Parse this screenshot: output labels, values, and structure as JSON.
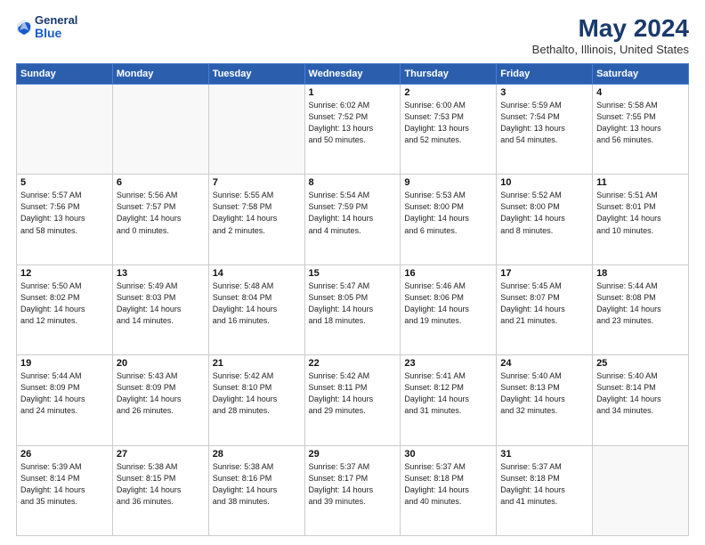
{
  "logo": {
    "general": "General",
    "blue": "Blue"
  },
  "header": {
    "month_year": "May 2024",
    "location": "Bethalto, Illinois, United States"
  },
  "weekdays": [
    "Sunday",
    "Monday",
    "Tuesday",
    "Wednesday",
    "Thursday",
    "Friday",
    "Saturday"
  ],
  "weeks": [
    [
      {
        "day": "",
        "info": ""
      },
      {
        "day": "",
        "info": ""
      },
      {
        "day": "",
        "info": ""
      },
      {
        "day": "1",
        "info": "Sunrise: 6:02 AM\nSunset: 7:52 PM\nDaylight: 13 hours\nand 50 minutes."
      },
      {
        "day": "2",
        "info": "Sunrise: 6:00 AM\nSunset: 7:53 PM\nDaylight: 13 hours\nand 52 minutes."
      },
      {
        "day": "3",
        "info": "Sunrise: 5:59 AM\nSunset: 7:54 PM\nDaylight: 13 hours\nand 54 minutes."
      },
      {
        "day": "4",
        "info": "Sunrise: 5:58 AM\nSunset: 7:55 PM\nDaylight: 13 hours\nand 56 minutes."
      }
    ],
    [
      {
        "day": "5",
        "info": "Sunrise: 5:57 AM\nSunset: 7:56 PM\nDaylight: 13 hours\nand 58 minutes."
      },
      {
        "day": "6",
        "info": "Sunrise: 5:56 AM\nSunset: 7:57 PM\nDaylight: 14 hours\nand 0 minutes."
      },
      {
        "day": "7",
        "info": "Sunrise: 5:55 AM\nSunset: 7:58 PM\nDaylight: 14 hours\nand 2 minutes."
      },
      {
        "day": "8",
        "info": "Sunrise: 5:54 AM\nSunset: 7:59 PM\nDaylight: 14 hours\nand 4 minutes."
      },
      {
        "day": "9",
        "info": "Sunrise: 5:53 AM\nSunset: 8:00 PM\nDaylight: 14 hours\nand 6 minutes."
      },
      {
        "day": "10",
        "info": "Sunrise: 5:52 AM\nSunset: 8:00 PM\nDaylight: 14 hours\nand 8 minutes."
      },
      {
        "day": "11",
        "info": "Sunrise: 5:51 AM\nSunset: 8:01 PM\nDaylight: 14 hours\nand 10 minutes."
      }
    ],
    [
      {
        "day": "12",
        "info": "Sunrise: 5:50 AM\nSunset: 8:02 PM\nDaylight: 14 hours\nand 12 minutes."
      },
      {
        "day": "13",
        "info": "Sunrise: 5:49 AM\nSunset: 8:03 PM\nDaylight: 14 hours\nand 14 minutes."
      },
      {
        "day": "14",
        "info": "Sunrise: 5:48 AM\nSunset: 8:04 PM\nDaylight: 14 hours\nand 16 minutes."
      },
      {
        "day": "15",
        "info": "Sunrise: 5:47 AM\nSunset: 8:05 PM\nDaylight: 14 hours\nand 18 minutes."
      },
      {
        "day": "16",
        "info": "Sunrise: 5:46 AM\nSunset: 8:06 PM\nDaylight: 14 hours\nand 19 minutes."
      },
      {
        "day": "17",
        "info": "Sunrise: 5:45 AM\nSunset: 8:07 PM\nDaylight: 14 hours\nand 21 minutes."
      },
      {
        "day": "18",
        "info": "Sunrise: 5:44 AM\nSunset: 8:08 PM\nDaylight: 14 hours\nand 23 minutes."
      }
    ],
    [
      {
        "day": "19",
        "info": "Sunrise: 5:44 AM\nSunset: 8:09 PM\nDaylight: 14 hours\nand 24 minutes."
      },
      {
        "day": "20",
        "info": "Sunrise: 5:43 AM\nSunset: 8:09 PM\nDaylight: 14 hours\nand 26 minutes."
      },
      {
        "day": "21",
        "info": "Sunrise: 5:42 AM\nSunset: 8:10 PM\nDaylight: 14 hours\nand 28 minutes."
      },
      {
        "day": "22",
        "info": "Sunrise: 5:42 AM\nSunset: 8:11 PM\nDaylight: 14 hours\nand 29 minutes."
      },
      {
        "day": "23",
        "info": "Sunrise: 5:41 AM\nSunset: 8:12 PM\nDaylight: 14 hours\nand 31 minutes."
      },
      {
        "day": "24",
        "info": "Sunrise: 5:40 AM\nSunset: 8:13 PM\nDaylight: 14 hours\nand 32 minutes."
      },
      {
        "day": "25",
        "info": "Sunrise: 5:40 AM\nSunset: 8:14 PM\nDaylight: 14 hours\nand 34 minutes."
      }
    ],
    [
      {
        "day": "26",
        "info": "Sunrise: 5:39 AM\nSunset: 8:14 PM\nDaylight: 14 hours\nand 35 minutes."
      },
      {
        "day": "27",
        "info": "Sunrise: 5:38 AM\nSunset: 8:15 PM\nDaylight: 14 hours\nand 36 minutes."
      },
      {
        "day": "28",
        "info": "Sunrise: 5:38 AM\nSunset: 8:16 PM\nDaylight: 14 hours\nand 38 minutes."
      },
      {
        "day": "29",
        "info": "Sunrise: 5:37 AM\nSunset: 8:17 PM\nDaylight: 14 hours\nand 39 minutes."
      },
      {
        "day": "30",
        "info": "Sunrise: 5:37 AM\nSunset: 8:18 PM\nDaylight: 14 hours\nand 40 minutes."
      },
      {
        "day": "31",
        "info": "Sunrise: 5:37 AM\nSunset: 8:18 PM\nDaylight: 14 hours\nand 41 minutes."
      },
      {
        "day": "",
        "info": ""
      }
    ]
  ]
}
